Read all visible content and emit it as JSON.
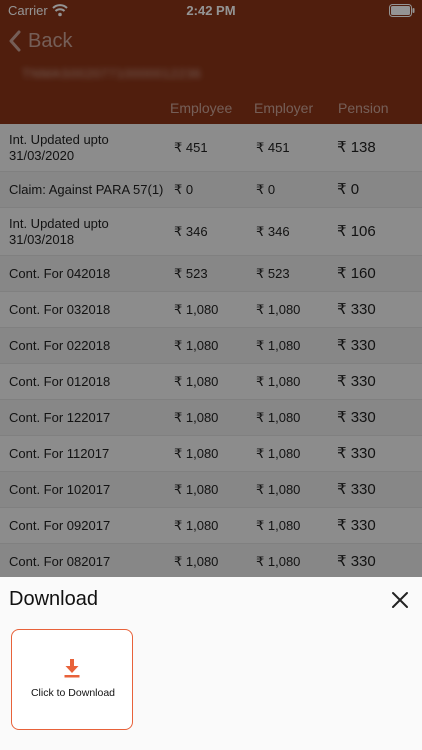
{
  "status_bar": {
    "carrier": "Carrier",
    "time": "2:42 PM"
  },
  "nav": {
    "back_label": "Back"
  },
  "account": {
    "number": "TNMAS00207710000012236"
  },
  "columns": {
    "employee": "Employee",
    "employer": "Employer",
    "pension": "Pension"
  },
  "rows": [
    {
      "label": "Int. Updated upto 31/03/2020",
      "employee": "₹ 451",
      "employer": "₹ 451",
      "pension": "₹ 138"
    },
    {
      "label": "Claim: Against PARA 57(1)",
      "employee": "₹ 0",
      "employer": "₹ 0",
      "pension": "₹ 0"
    },
    {
      "label": "Int. Updated upto 31/03/2018",
      "employee": "₹ 346",
      "employer": "₹ 346",
      "pension": "₹ 106"
    },
    {
      "label": "Cont. For 042018",
      "employee": "₹ 523",
      "employer": "₹ 523",
      "pension": "₹ 160"
    },
    {
      "label": "Cont. For 032018",
      "employee": "₹ 1,080",
      "employer": "₹ 1,080",
      "pension": "₹ 330"
    },
    {
      "label": "Cont. For 022018",
      "employee": "₹ 1,080",
      "employer": "₹ 1,080",
      "pension": "₹ 330"
    },
    {
      "label": "Cont. For 012018",
      "employee": "₹ 1,080",
      "employer": "₹ 1,080",
      "pension": "₹ 330"
    },
    {
      "label": "Cont. For 122017",
      "employee": "₹ 1,080",
      "employer": "₹ 1,080",
      "pension": "₹ 330"
    },
    {
      "label": "Cont. For 112017",
      "employee": "₹ 1,080",
      "employer": "₹ 1,080",
      "pension": "₹ 330"
    },
    {
      "label": "Cont. For 102017",
      "employee": "₹ 1,080",
      "employer": "₹ 1,080",
      "pension": "₹ 330"
    },
    {
      "label": "Cont. For 092017",
      "employee": "₹ 1,080",
      "employer": "₹ 1,080",
      "pension": "₹ 330"
    },
    {
      "label": "Cont. For 082017",
      "employee": "₹ 1,080",
      "employer": "₹ 1,080",
      "pension": "₹ 330"
    }
  ],
  "sheet": {
    "title": "Download",
    "download_label": "Click to Download"
  },
  "colors": {
    "header": "#8a3417",
    "accent": "#e8623a"
  }
}
